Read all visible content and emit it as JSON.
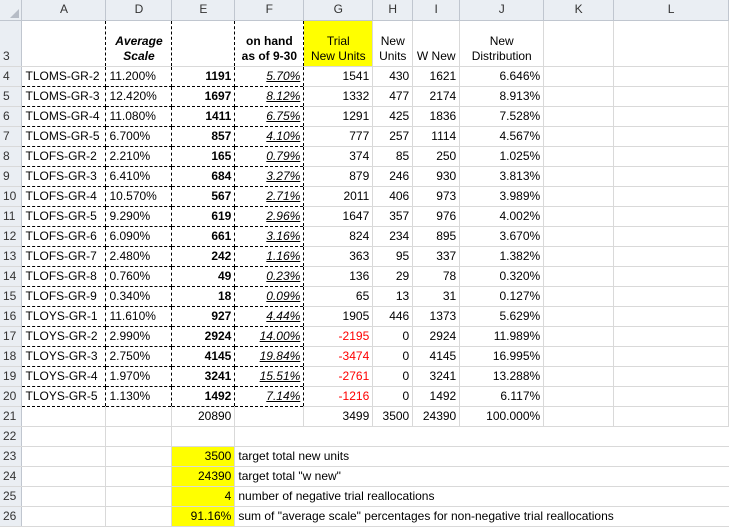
{
  "columns": [
    "A",
    "D",
    "E",
    "F",
    "G",
    "H",
    "I",
    "J",
    "K",
    "L"
  ],
  "header_row": {
    "row_num": "3",
    "average_scale": "Average\nScale",
    "on_hand": "on hand\nas of  9-30",
    "trial_new_units": "Trial\nNew Units",
    "new_units": "New\nUnits",
    "w_new": "W New",
    "new_distribution": "New\nDistribution"
  },
  "rows": [
    {
      "n": "4",
      "a": "TLOMS-GR-2",
      "d": "11.200%",
      "e": "1191",
      "f": "5.70%",
      "g": "1541",
      "h": "430",
      "i": "1621",
      "j": "6.646%"
    },
    {
      "n": "5",
      "a": "TLOMS-GR-3",
      "d": "12.420%",
      "e": "1697",
      "f": "8.12%",
      "g": "1332",
      "h": "477",
      "i": "2174",
      "j": "8.913%"
    },
    {
      "n": "6",
      "a": "TLOMS-GR-4",
      "d": "11.080%",
      "e": "1411",
      "f": "6.75%",
      "g": "1291",
      "h": "425",
      "i": "1836",
      "j": "7.528%"
    },
    {
      "n": "7",
      "a": "TLOMS-GR-5",
      "d": "6.700%",
      "e": "857",
      "f": "4.10%",
      "g": "777",
      "h": "257",
      "i": "1114",
      "j": "4.567%"
    },
    {
      "n": "8",
      "a": "TLOFS-GR-2",
      "d": "2.210%",
      "e": "165",
      "f": "0.79%",
      "g": "374",
      "h": "85",
      "i": "250",
      "j": "1.025%"
    },
    {
      "n": "9",
      "a": "TLOFS-GR-3",
      "d": "6.410%",
      "e": "684",
      "f": "3.27%",
      "g": "879",
      "h": "246",
      "i": "930",
      "j": "3.813%"
    },
    {
      "n": "10",
      "a": "TLOFS-GR-4",
      "d": "10.570%",
      "e": "567",
      "f": "2.71%",
      "g": "2011",
      "h": "406",
      "i": "973",
      "j": "3.989%"
    },
    {
      "n": "11",
      "a": "TLOFS-GR-5",
      "d": "9.290%",
      "e": "619",
      "f": "2.96%",
      "g": "1647",
      "h": "357",
      "i": "976",
      "j": "4.002%"
    },
    {
      "n": "12",
      "a": "TLOFS-GR-6",
      "d": "6.090%",
      "e": "661",
      "f": "3.16%",
      "g": "824",
      "h": "234",
      "i": "895",
      "j": "3.670%"
    },
    {
      "n": "13",
      "a": "TLOFS-GR-7",
      "d": "2.480%",
      "e": "242",
      "f": "1.16%",
      "g": "363",
      "h": "95",
      "i": "337",
      "j": "1.382%"
    },
    {
      "n": "14",
      "a": "TLOFS-GR-8",
      "d": "0.760%",
      "e": "49",
      "f": "0.23%",
      "g": "136",
      "h": "29",
      "i": "78",
      "j": "0.320%"
    },
    {
      "n": "15",
      "a": "TLOFS-GR-9",
      "d": "0.340%",
      "e": "18",
      "f": "0.09%",
      "g": "65",
      "h": "13",
      "i": "31",
      "j": "0.127%"
    },
    {
      "n": "16",
      "a": "TLOYS-GR-1",
      "d": "11.610%",
      "e": "927",
      "f": "4.44%",
      "g": "1905",
      "h": "446",
      "i": "1373",
      "j": "5.629%"
    },
    {
      "n": "17",
      "a": "TLOYS-GR-2",
      "d": "2.990%",
      "e": "2924",
      "f": "14.00%",
      "g": "-2195",
      "h": "0",
      "i": "2924",
      "j": "11.989%"
    },
    {
      "n": "18",
      "a": "TLOYS-GR-3",
      "d": "2.750%",
      "e": "4145",
      "f": "19.84%",
      "g": "-3474",
      "h": "0",
      "i": "4145",
      "j": "16.995%"
    },
    {
      "n": "19",
      "a": "TLOYS-GR-4",
      "d": "1.970%",
      "e": "3241",
      "f": "15.51%",
      "g": "-2761",
      "h": "0",
      "i": "3241",
      "j": "13.288%"
    },
    {
      "n": "20",
      "a": "TLOYS-GR-5",
      "d": "1.130%",
      "e": "1492",
      "f": "7.14%",
      "g": "-1216",
      "h": "0",
      "i": "1492",
      "j": "6.117%"
    }
  ],
  "totals": {
    "n": "21",
    "e": "20890",
    "g": "3499",
    "h": "3500",
    "i": "24390",
    "j": "100.000%"
  },
  "notes": [
    {
      "n": "22",
      "value": "",
      "text": ""
    },
    {
      "n": "23",
      "value": "3500",
      "text": "target total new units"
    },
    {
      "n": "24",
      "value": "24390",
      "text": "target total \"w new\""
    },
    {
      "n": "25",
      "value": "4",
      "text": "number of negative trial reallocations"
    },
    {
      "n": "26",
      "value": "91.16%",
      "text": "sum of \"average scale\" percentages for non-negative trial reallocations"
    }
  ],
  "colors": {
    "highlight": "#ffff00",
    "negative": "#ff0000",
    "header_bg": "#eaeef3"
  }
}
